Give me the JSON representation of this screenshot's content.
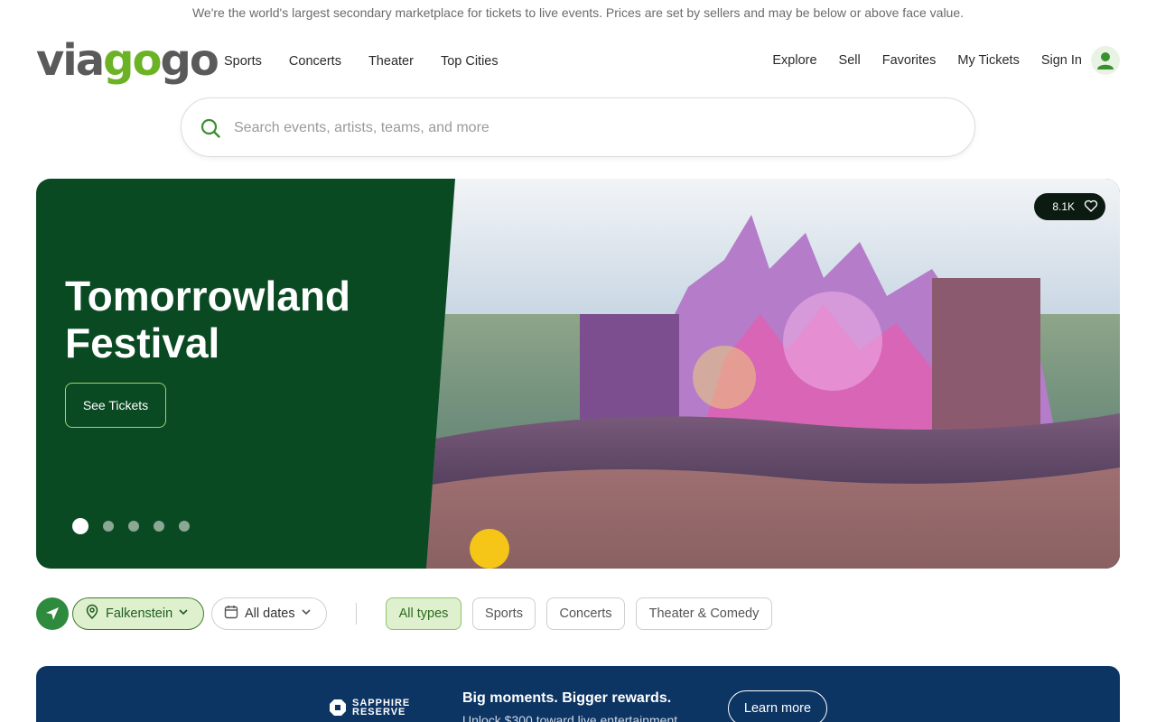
{
  "disclaimer": "We're the world's largest secondary marketplace for tickets to live events. Prices are set by sellers and may be below or above face value.",
  "logo": {
    "part1": "via",
    "part2": "go",
    "part3": "go"
  },
  "nav": {
    "left": [
      "Sports",
      "Concerts",
      "Theater",
      "Top Cities"
    ],
    "right": [
      "Explore",
      "Sell",
      "Favorites",
      "My Tickets",
      "Sign In"
    ]
  },
  "search": {
    "placeholder": "Search events, artists, teams, and more"
  },
  "hero": {
    "title_line1": "Tomorrowland",
    "title_line2": "Festival",
    "button": "See Tickets",
    "favorites_count": "8.1K",
    "slide_count": 5,
    "active_slide": 1
  },
  "filters": {
    "location": "Falkenstein",
    "dates": "All dates",
    "types": [
      "All types",
      "Sports",
      "Concerts",
      "Theater & Comedy"
    ],
    "active_type": "All types"
  },
  "promo": {
    "brand_line1": "SAPPHIRE",
    "brand_line2": "RESERVE",
    "headline": "Big moments. Bigger rewards.",
    "subtext": "Unlock $300 toward live entertainment",
    "button": "Learn more"
  },
  "colors": {
    "brand_green": "#6bb325",
    "hero_bg": "#0a4a22",
    "promo_bg": "#0d3563",
    "active_pill": "#dff0cf"
  }
}
